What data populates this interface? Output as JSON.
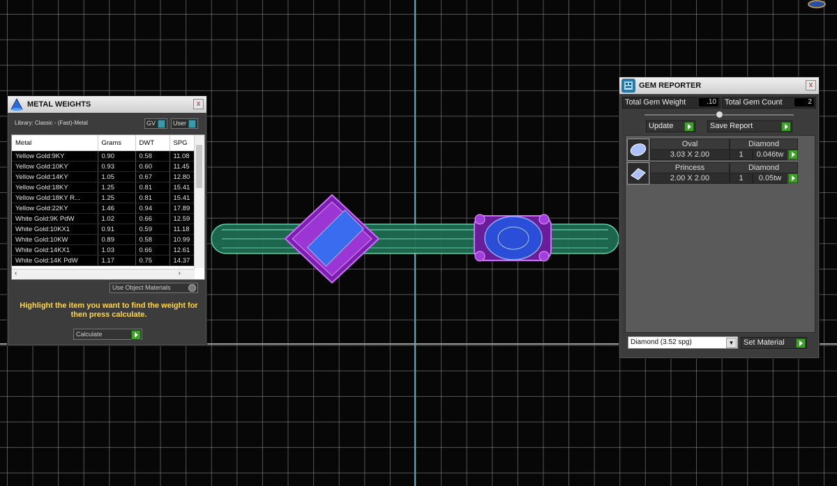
{
  "metal_weights": {
    "title": "METAL WEIGHTS",
    "close": "x",
    "library_label": "Library: Classic - (Fast)-Metal",
    "gv_label": "GV",
    "user_label": "User",
    "columns": [
      "Metal",
      "Grams",
      "DWT",
      "SPG"
    ],
    "rows": [
      [
        "Yellow Gold:9KY",
        "0.90",
        "0.58",
        "11.08"
      ],
      [
        "Yellow Gold:10KY",
        "0.93",
        "0.60",
        "11.45"
      ],
      [
        "Yellow Gold:14KY",
        "1.05",
        "0.67",
        "12.80"
      ],
      [
        "Yellow Gold:18KY",
        "1.25",
        "0.81",
        "15.41"
      ],
      [
        "Yellow Gold:18KY R...",
        "1.25",
        "0.81",
        "15.41"
      ],
      [
        "Yellow Gold:22KY",
        "1.46",
        "0.94",
        "17.89"
      ],
      [
        "White Gold:9K PdW",
        "1.02",
        "0.66",
        "12.59"
      ],
      [
        "White Gold:10KX1",
        "0.91",
        "0.59",
        "11.18"
      ],
      [
        "White Gold:10KW",
        "0.89",
        "0.58",
        "10.99"
      ],
      [
        "White Gold:14KX1",
        "1.03",
        "0.66",
        "12.61"
      ],
      [
        "White Gold:14K PdW",
        "1.17",
        "0.75",
        "14.37"
      ]
    ],
    "use_object_materials": "Use Object Materials",
    "hint": "Highlight the item you want to find the weight for then press calculate.",
    "calculate_label": "Calculate"
  },
  "gem_reporter": {
    "title": "GEM REPORTER",
    "close": "x",
    "total_weight_label": "Total Gem Weight",
    "total_weight_value": ".10",
    "total_count_label": "Total Gem Count",
    "total_count_value": "2",
    "update_label": "Update",
    "save_report_label": "Save Report",
    "gems": [
      {
        "shape": "Oval",
        "material": "Diamond",
        "size": "3.03 X 2.00",
        "count": "1",
        "weight": "0.046tw"
      },
      {
        "shape": "Princess",
        "material": "Diamond",
        "size": "2.00 X 2.00",
        "count": "1",
        "weight": "0.05tw"
      }
    ],
    "material_select": "Diamond     (3.52 spg)",
    "set_material_label": "Set Material"
  },
  "colors": {
    "band": "#3fae88",
    "setting": "#a032d8",
    "gem": "#3a6cf0"
  }
}
